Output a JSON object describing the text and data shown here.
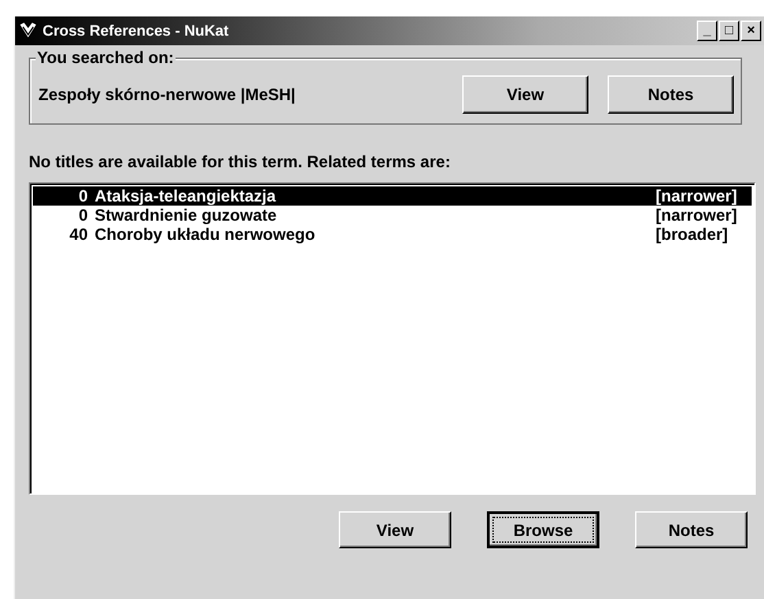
{
  "window": {
    "title": "Cross References - NuKat",
    "controls": [
      "_",
      "□",
      "×"
    ]
  },
  "search_group": {
    "legend": "You searched on:",
    "term": "Zespoły skórno-nerwowe |MeSH|",
    "buttons": [
      {
        "label": "View",
        "focused": false
      },
      {
        "label": "Notes",
        "focused": false
      }
    ]
  },
  "message": "No titles are available for this term.  Related terms are:",
  "terms": [
    {
      "count": "0",
      "term": "Ataksja-teleangiektazja",
      "relation": "[narrower]",
      "selected": true
    },
    {
      "count": "0",
      "term": "Stwardnienie guzowate",
      "relation": "[narrower]",
      "selected": false
    },
    {
      "count": "40",
      "term": "Choroby układu nerwowego",
      "relation": "[broader]",
      "selected": false
    }
  ],
  "buttons": [
    {
      "label": "View",
      "focused": false
    },
    {
      "label": "Browse",
      "focused": true
    },
    {
      "label": "Notes",
      "focused": false
    }
  ]
}
